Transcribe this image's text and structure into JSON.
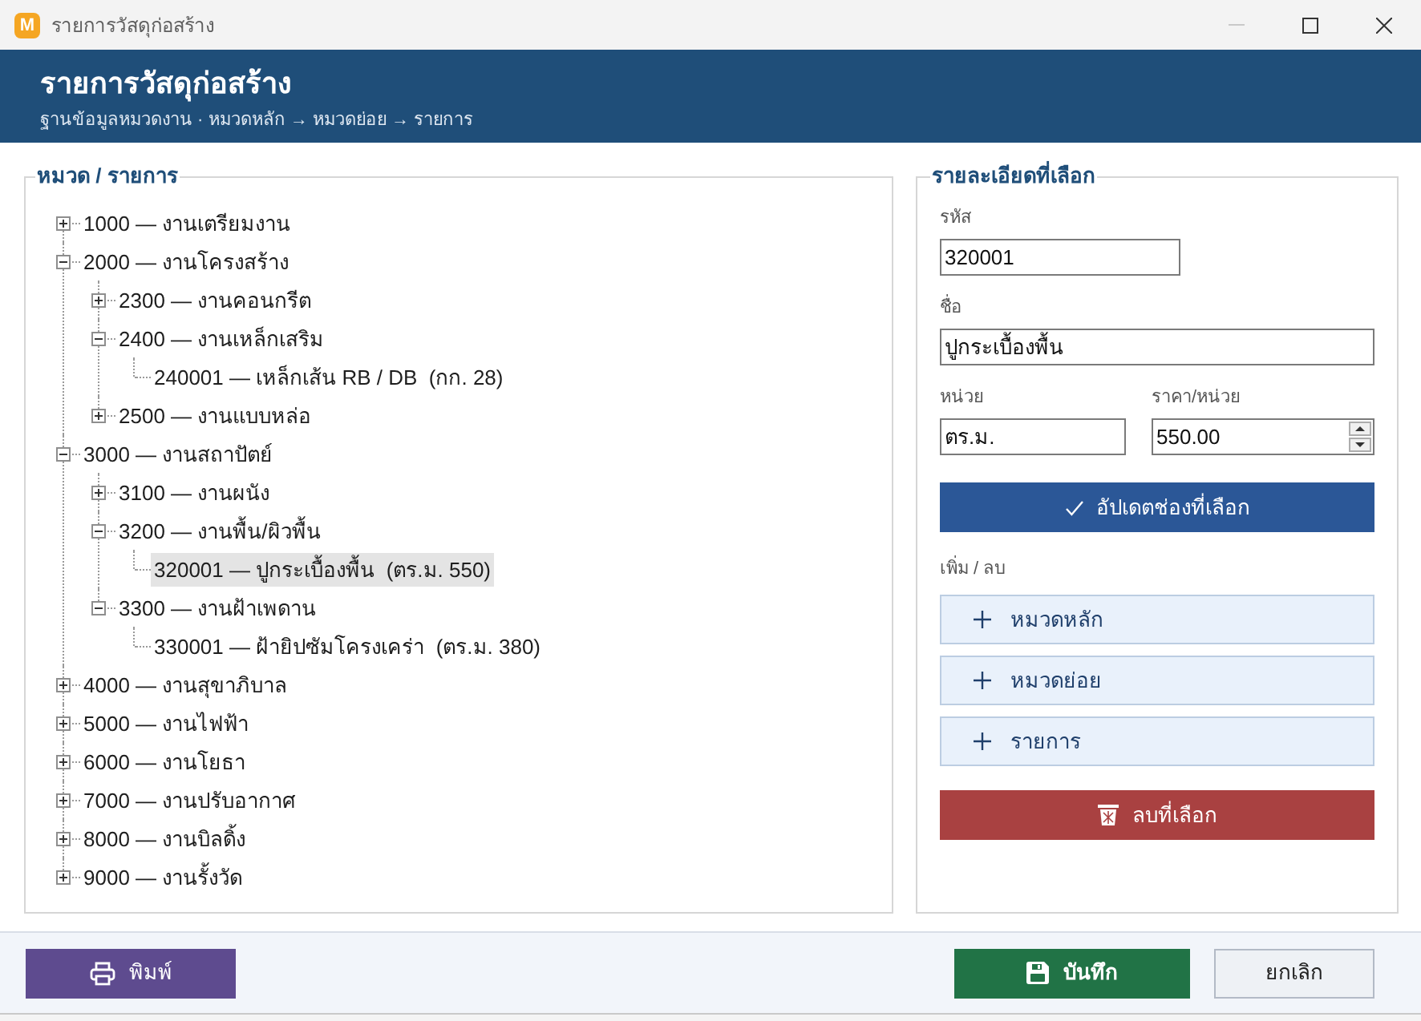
{
  "window": {
    "logo_letter": "M",
    "title": "รายการวัสดุก่อสร้าง"
  },
  "header": {
    "title": "รายการวัสดุก่อสร้าง",
    "subtitle": "ฐานข้อมูลหมวดงาน · หมวดหลัก → หมวดย่อย → รายการ"
  },
  "tree": {
    "legend": "หมวด / รายการ",
    "items": [
      {
        "kind": "category",
        "label": "1000 — งานเตรียมงาน",
        "expanded": false,
        "selected": false
      },
      {
        "kind": "category",
        "label": "2000 — งานโครงสร้าง",
        "expanded": true,
        "selected": false,
        "children": [
          {
            "kind": "category",
            "label": "2300 — งานคอนกรีต",
            "expanded": false,
            "selected": false
          },
          {
            "kind": "category",
            "label": "2400 — งานเหล็กเสริม",
            "expanded": true,
            "selected": false,
            "children": [
              {
                "kind": "item",
                "label": "240001 — เหล็กเส้น RB / DB  (กก. 28)",
                "selected": false
              }
            ]
          },
          {
            "kind": "category",
            "label": "2500 — งานแบบหล่อ",
            "expanded": false,
            "selected": false
          }
        ]
      },
      {
        "kind": "category",
        "label": "3000 — งานสถาปัตย์",
        "expanded": true,
        "selected": false,
        "children": [
          {
            "kind": "category",
            "label": "3100 — งานผนัง",
            "expanded": false,
            "selected": false
          },
          {
            "kind": "category",
            "label": "3200 — งานพื้น/ผิวพื้น",
            "expanded": true,
            "selected": false,
            "children": [
              {
                "kind": "item",
                "label": "320001 — ปูกระเบื้องพื้น  (ตร.ม. 550)",
                "selected": true
              }
            ]
          },
          {
            "kind": "category",
            "label": "3300 — งานฝ้าเพดาน",
            "expanded": true,
            "selected": false,
            "children": [
              {
                "kind": "item",
                "label": "330001 — ฝ้ายิปซัมโครงเคร่า  (ตร.ม. 380)",
                "selected": false
              }
            ]
          }
        ]
      },
      {
        "kind": "category",
        "label": "4000 — งานสุขาภิบาล",
        "expanded": false,
        "selected": false
      },
      {
        "kind": "category",
        "label": "5000 — งานไฟฟ้า",
        "expanded": false,
        "selected": false
      },
      {
        "kind": "category",
        "label": "6000 — งานโยธา",
        "expanded": false,
        "selected": false
      },
      {
        "kind": "category",
        "label": "7000 — งานปรับอากาศ",
        "expanded": false,
        "selected": false
      },
      {
        "kind": "category",
        "label": "8000 — งานบิลดิ้ง",
        "expanded": false,
        "selected": false
      },
      {
        "kind": "category",
        "label": "9000 — งานรั้งวัด",
        "expanded": false,
        "selected": false
      }
    ]
  },
  "details": {
    "legend": "รายละเอียดที่เลือก",
    "fields": [
      {
        "kind": "text",
        "label": "รหัส",
        "value": "320001"
      },
      {
        "kind": "text",
        "label": "ชื่อ",
        "value": "ปูกระเบื้องพื้น"
      },
      {
        "kind": "text",
        "label": "หน่วย",
        "value": "ตร.ม."
      },
      {
        "kind": "spin",
        "label": "ราคา/หน่วย",
        "value": "550.00"
      }
    ],
    "update_button": "อัปเดตช่องที่เลือก",
    "add_remove_label": "เพิ่ม / ลบ",
    "add_buttons": [
      "หมวดหลัก",
      "หมวดย่อย",
      "รายการ"
    ],
    "delete_button": "ลบที่เลือก"
  },
  "footer": {
    "print_button": "พิมพ์",
    "save_button": "บันทึก",
    "cancel_button": "ยกเลิก"
  }
}
